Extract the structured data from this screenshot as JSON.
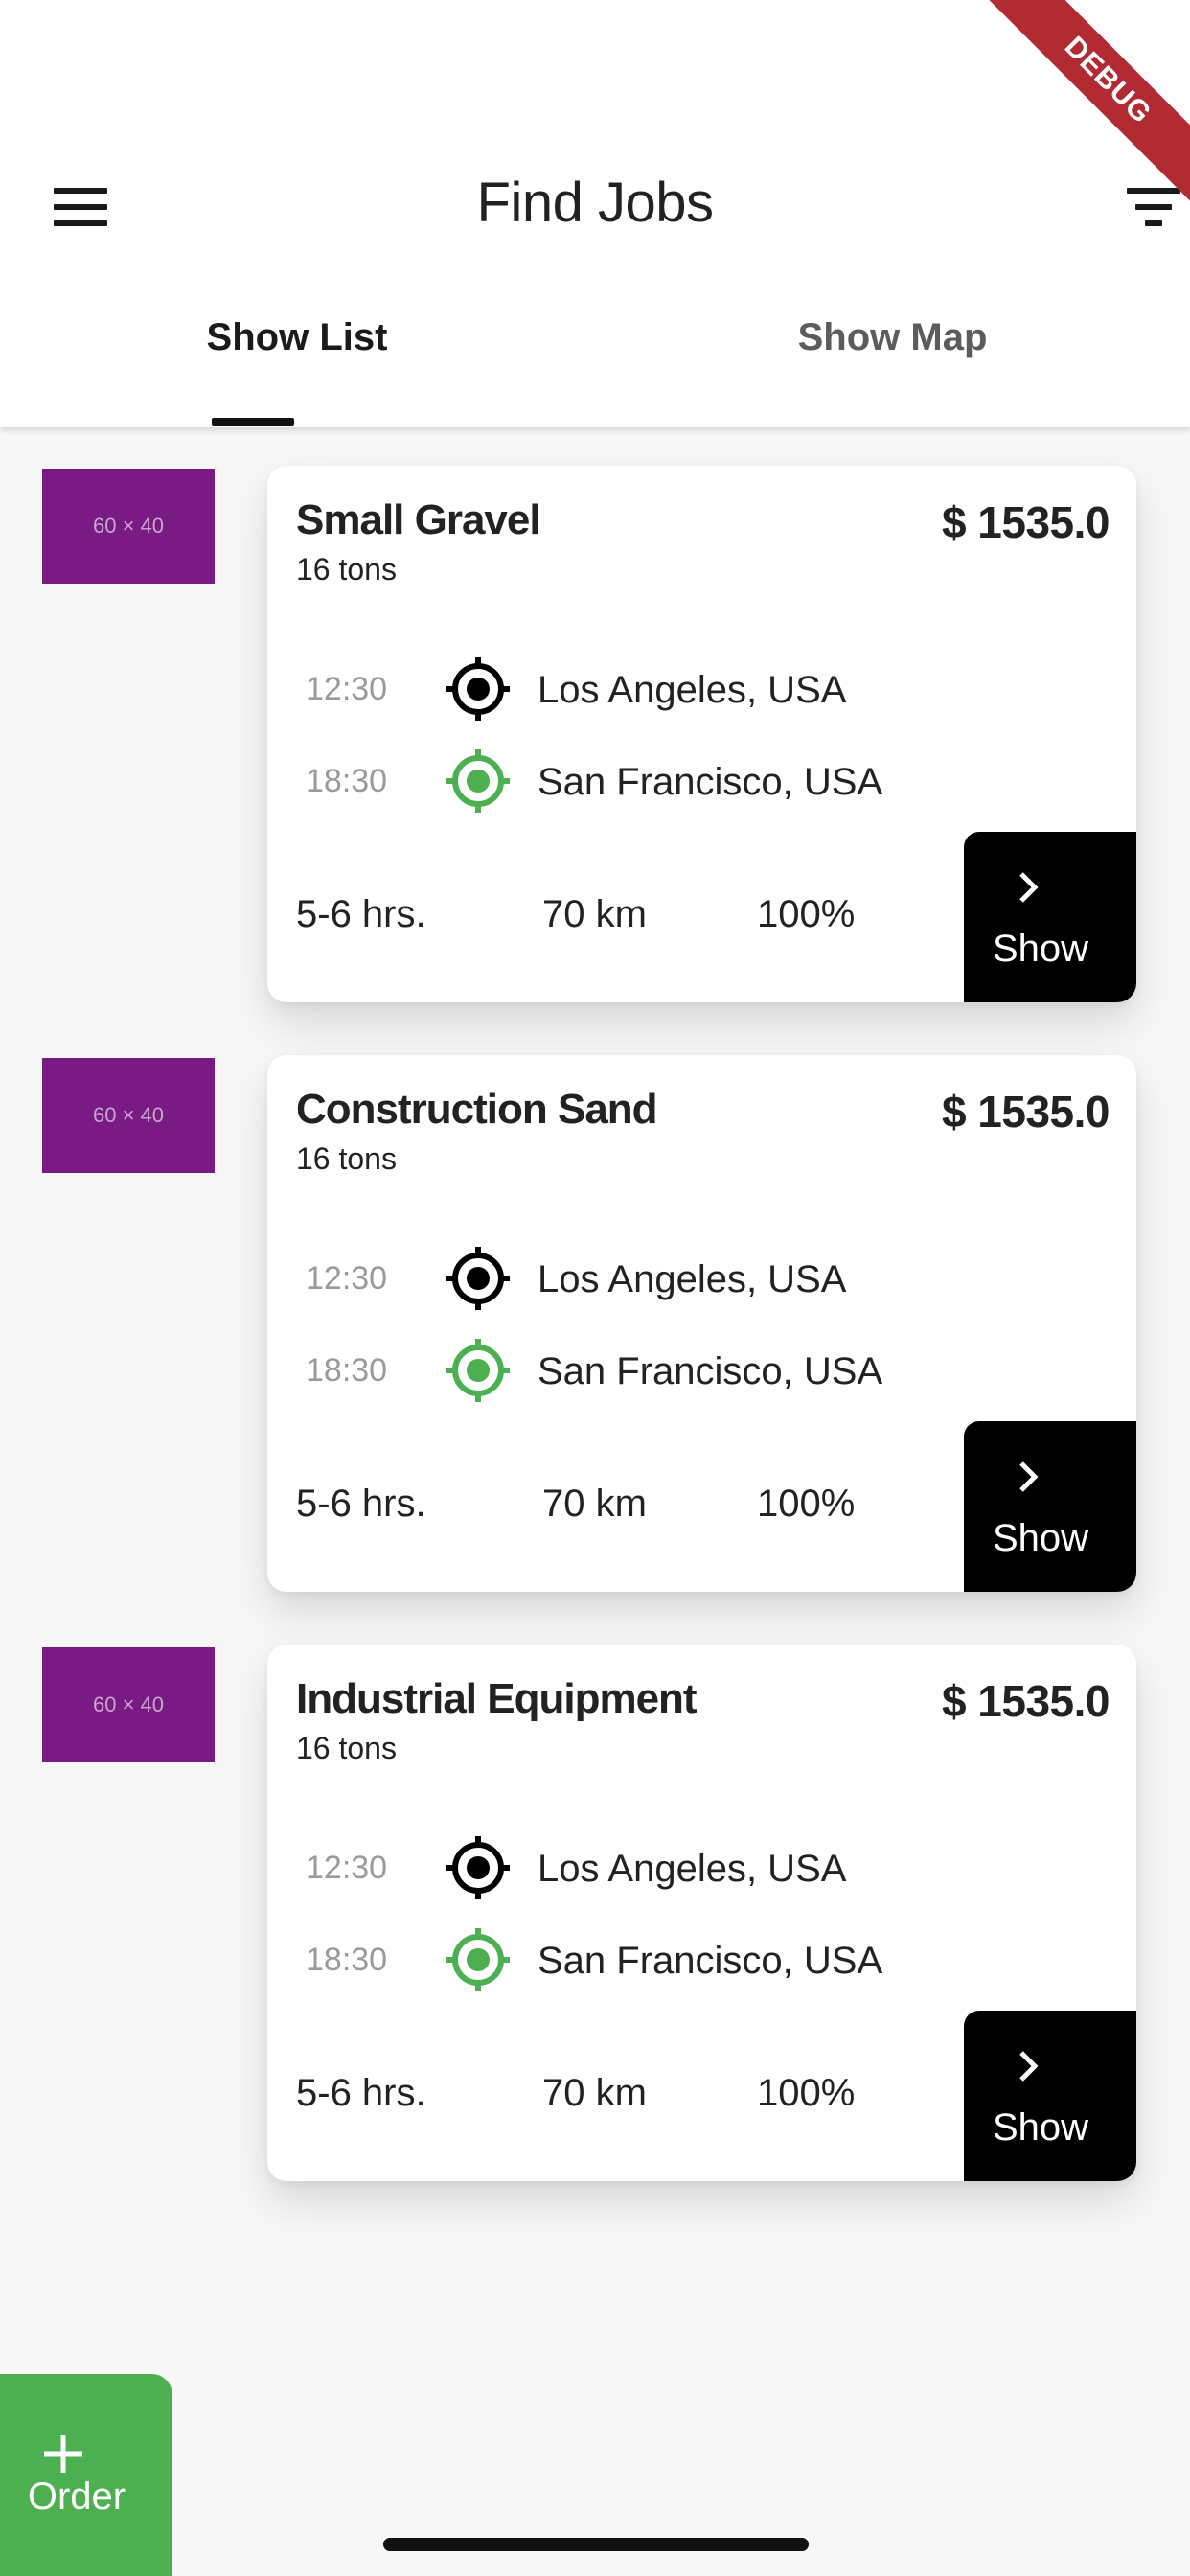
{
  "debug_banner": "DEBUG",
  "header": {
    "title": "Find Jobs",
    "menu_icon": "menu-icon",
    "filter_icon": "filter-icon"
  },
  "tabs": [
    {
      "label": "Show List",
      "selected": true
    },
    {
      "label": "Show Map",
      "selected": false
    }
  ],
  "jobs": [
    {
      "thumb": "60 × 40",
      "title": "Small Gravel",
      "weight": "16 tons",
      "price": "$ 1535.0",
      "pickup": {
        "time": "12:30",
        "place": "Los Angeles, USA"
      },
      "dropoff": {
        "time": "18:30",
        "place": "San Francisco, USA"
      },
      "duration": "5-6 hrs.",
      "distance": "70 km",
      "percent": "100%",
      "action": "Show"
    },
    {
      "thumb": "60 × 40",
      "title": "Construction Sand",
      "weight": "16 tons",
      "price": "$ 1535.0",
      "pickup": {
        "time": "12:30",
        "place": "Los Angeles, USA"
      },
      "dropoff": {
        "time": "18:30",
        "place": "San Francisco, USA"
      },
      "duration": "5-6 hrs.",
      "distance": "70 km",
      "percent": "100%",
      "action": "Show"
    },
    {
      "thumb": "60 × 40",
      "title": "Industrial Equipment",
      "weight": "16 tons",
      "price": "$ 1535.0",
      "pickup": {
        "time": "12:30",
        "place": "Los Angeles, USA"
      },
      "dropoff": {
        "time": "18:30",
        "place": "San Francisco, USA"
      },
      "duration": "5-6 hrs.",
      "distance": "70 km",
      "percent": "100%",
      "action": "Show"
    }
  ],
  "fab": {
    "label": "Order"
  },
  "colors": {
    "accent_green": "#4caf50",
    "pickup_icon": "#000000",
    "dropoff_icon": "#4caf50",
    "thumb_bg": "#7a1a84",
    "debug_ribbon": "#b22a32"
  }
}
